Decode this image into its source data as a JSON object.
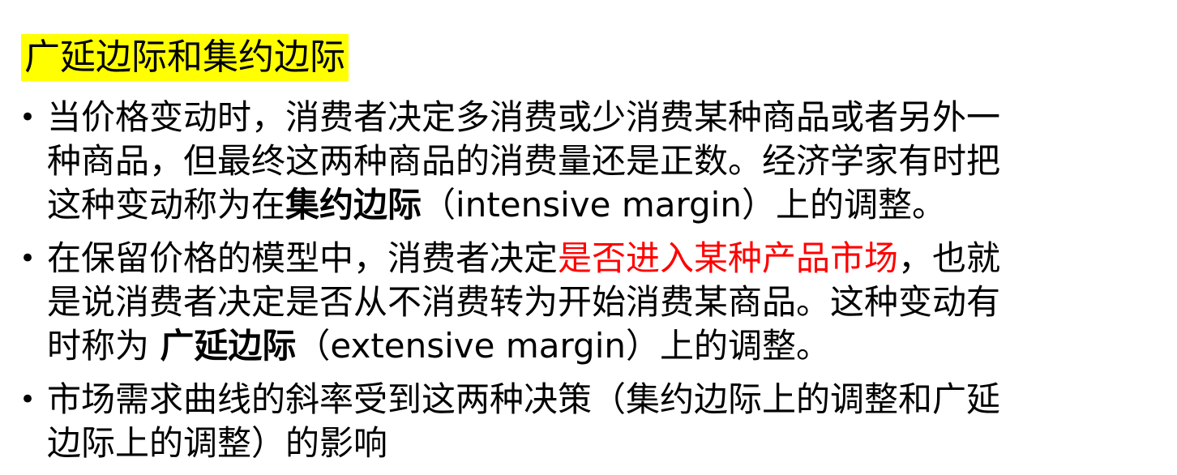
{
  "title": "广延边际和集约边际",
  "bullets": [
    {
      "lines": [
        {
          "parts": [
            {
              "text": "当价格变动时，消费者决定多消费或少消费某种商品或者另外一"
            }
          ]
        },
        {
          "parts": [
            {
              "text": "种商品，但最终这两种商品的消费量还是正数。经济学家有时把"
            }
          ]
        },
        {
          "parts": [
            {
              "text": "这种变动称为在"
            },
            {
              "text": "集约边际"
            },
            {
              "text": "（intensive margin）上的调整。"
            }
          ]
        }
      ]
    },
    {
      "lines": [
        {
          "parts": [
            {
              "text": "在保留价格的模型中，消费者决定"
            },
            {
              "text": "是否进入某种产品市场"
            },
            {
              "text": "，也就"
            }
          ]
        },
        {
          "parts": [
            {
              "text": "是说消费者决定是否从不消费转为开始消费某商品。这种变动有"
            }
          ]
        },
        {
          "parts": [
            {
              "text": "时称为 "
            },
            {
              "text": "广延边际"
            },
            {
              "text": "（extensive margin）上的调整。"
            }
          ]
        }
      ]
    },
    {
      "lines": [
        {
          "parts": [
            {
              "text": "市场需求曲线的斜率受到这两种决策（集约边际上的调整和广延"
            }
          ]
        },
        {
          "parts": [
            {
              "text": "边际上的调整）的影响"
            }
          ]
        }
      ]
    }
  ],
  "bullet_symbol": "•",
  "colors": {
    "title_highlight": "#ffff00",
    "emphasis_red": "#ff0000",
    "text": "#000000"
  }
}
